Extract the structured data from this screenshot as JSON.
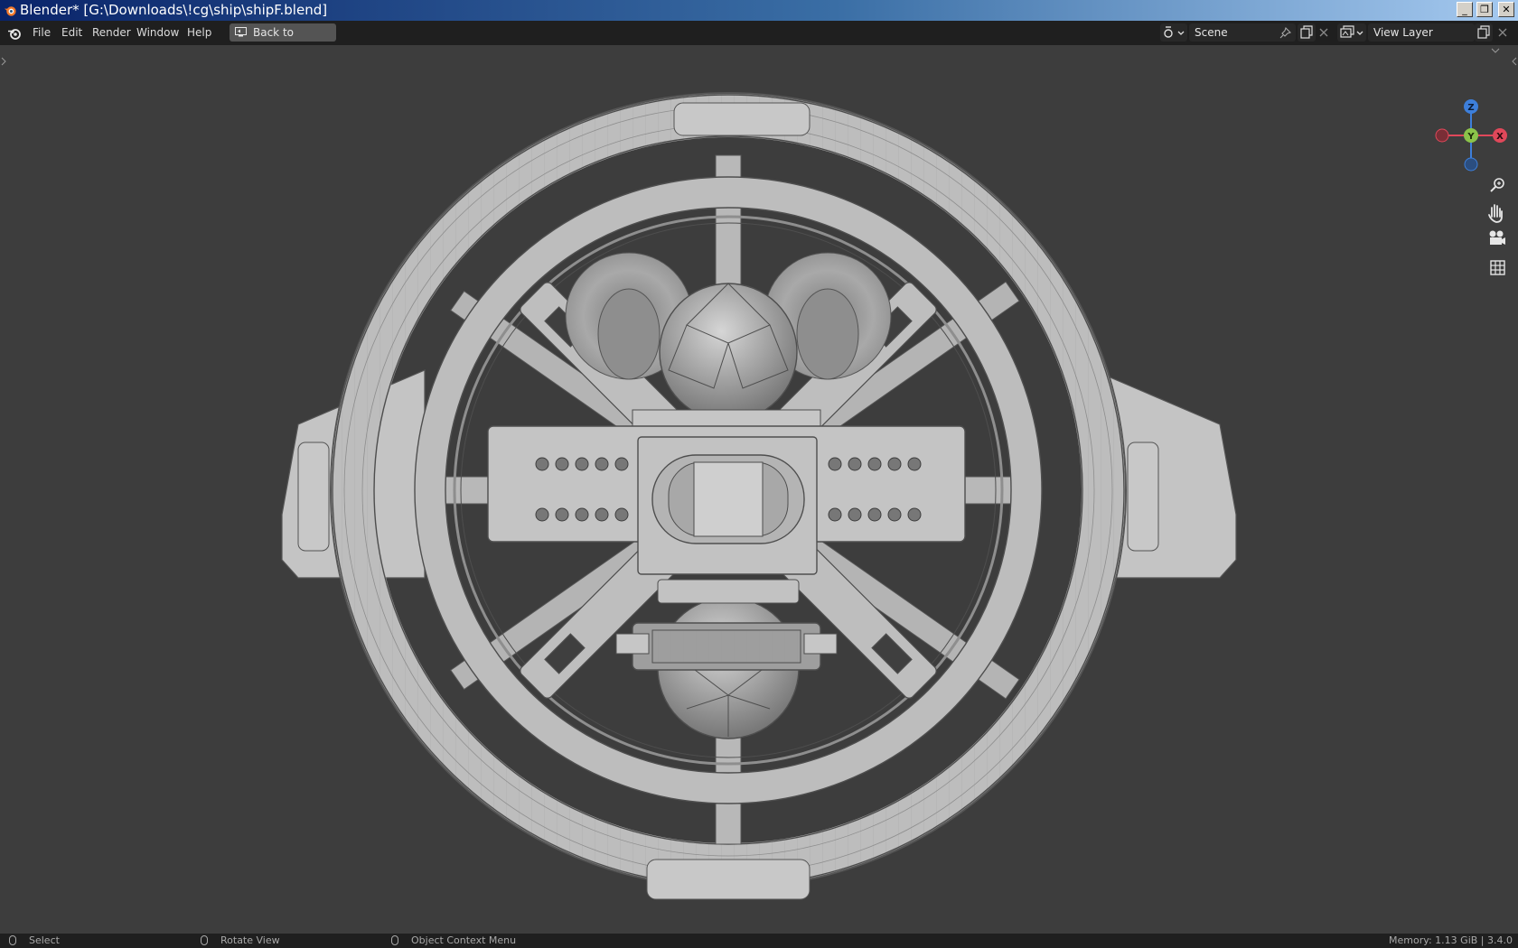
{
  "window": {
    "title": "Blender* [G:\\Downloads\\!cg\\ship\\shipF.blend]",
    "minimize_glyph": "_",
    "restore_glyph": "❐",
    "close_glyph": "✕"
  },
  "menubar": {
    "items": [
      "File",
      "Edit",
      "Render",
      "Window",
      "Help"
    ],
    "back_button": "Back to Previous",
    "scene": {
      "value": "Scene"
    },
    "view_layer": {
      "value": "View Layer"
    }
  },
  "navigation_gizmo": {
    "axes": {
      "z": "Z",
      "y": "Y",
      "x": "X"
    },
    "colors": {
      "x": "#e0485a",
      "y": "#8bc34a",
      "z": "#3d7fdb"
    },
    "tools": [
      "zoom-icon",
      "hand-pan-icon",
      "camera-icon",
      "grid-icon"
    ]
  },
  "statusbar": {
    "select": "Select",
    "rotate": "Rotate View",
    "context": "Object Context Menu",
    "memory": "Memory: 1.13 GiB | 3.4.0"
  },
  "colors": {
    "viewport_bg": "#3d3d3d",
    "header_bg": "#1f1f1f",
    "mesh_light": "#c9c9c9",
    "mesh_dark": "#7a7a7a"
  }
}
